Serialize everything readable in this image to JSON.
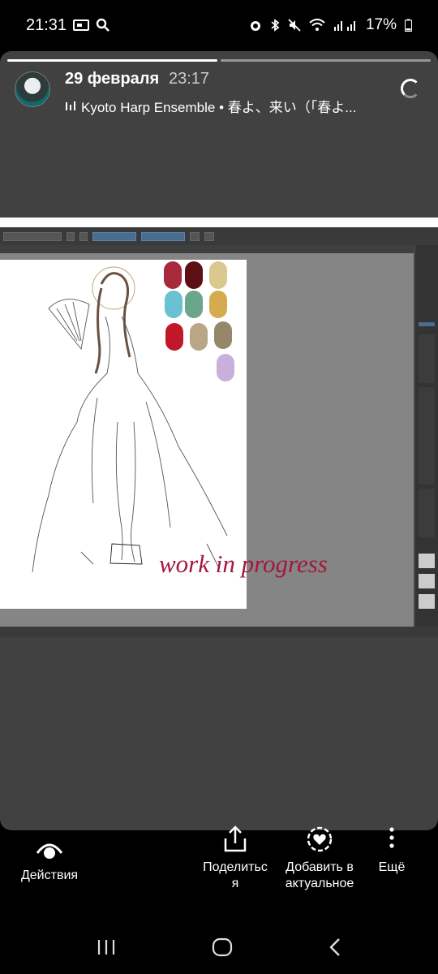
{
  "status_bar": {
    "time": "21:31",
    "battery": "17%"
  },
  "story": {
    "date": "29 февраля",
    "time": "23:17",
    "music": "Kyoto Harp Ensemble • 春よ、来い（「春よ..."
  },
  "screenshot": {
    "overlay_text": "work in progress",
    "palette_colors": [
      "#a8283c",
      "#5c1016",
      "#d9c98e",
      "#69c1d1",
      "#6ba58a",
      "#d4ab4e",
      "#c0182a",
      "#b8a686",
      "#96876a",
      "#c9b0db"
    ]
  },
  "actions": {
    "actions_label": "Действия",
    "share_label": "Поделитьс\nя",
    "highlight_label": "Добавить в\nактуальное",
    "more_label": "Ещё"
  },
  "colors": {
    "background": "#000000",
    "story_bg": "#414141",
    "accent_text": "#a3183a"
  }
}
